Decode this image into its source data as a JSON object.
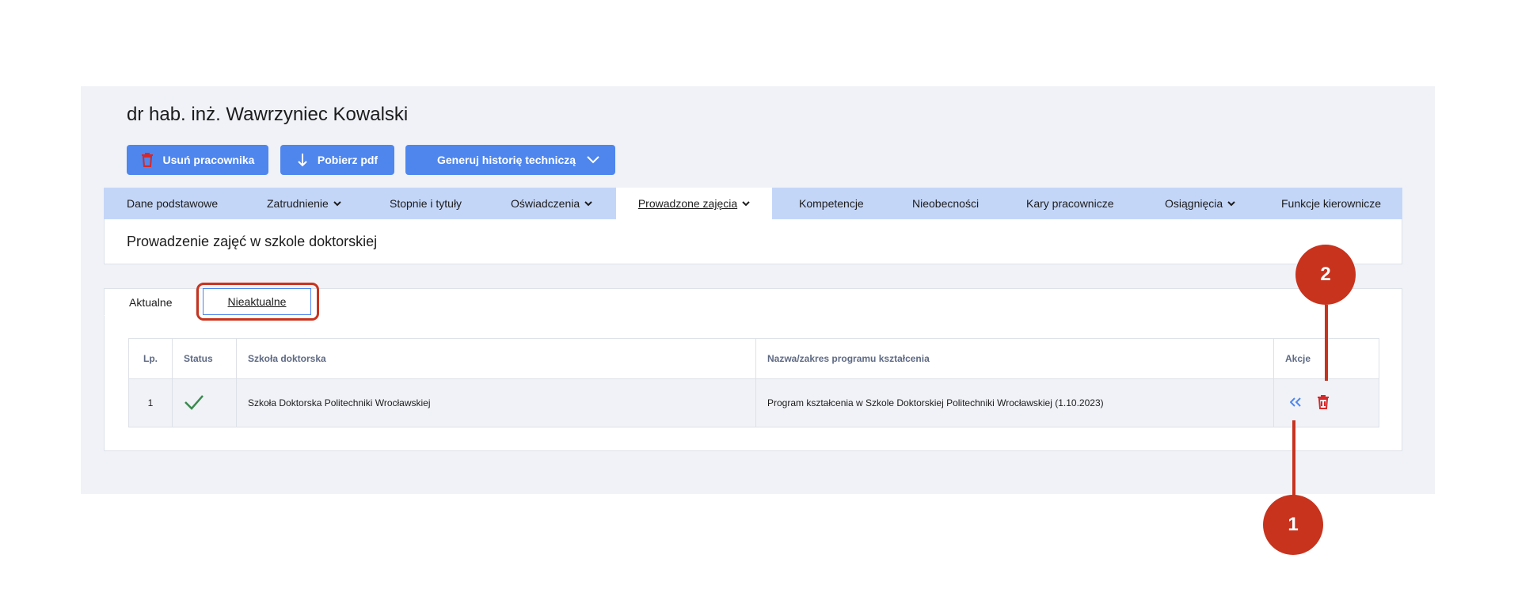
{
  "header": {
    "person_name": "dr hab. inż. Wawrzyniec Kowalski"
  },
  "toolbar": {
    "delete_label": "Usuń pracownika",
    "pdf_label": "Pobierz pdf",
    "generate_label": "Generuj historię techniczą"
  },
  "nav": {
    "tabs": [
      {
        "label": "Dane podstawowe"
      },
      {
        "label": "Zatrudnienie"
      },
      {
        "label": "Stopnie i tytuły"
      },
      {
        "label": "Oświadczenia"
      },
      {
        "label": "Prowadzone zajęcia"
      },
      {
        "label": "Kompetencje"
      },
      {
        "label": "Nieobecności"
      },
      {
        "label": "Kary pracownicze"
      },
      {
        "label": "Osiągnięcia"
      },
      {
        "label": "Funkcje kierownicze"
      }
    ]
  },
  "section": {
    "title": "Prowadzenie zajęć w szkole doktorskiej"
  },
  "subtabs": {
    "current": "Aktualne",
    "archived": "Nieaktualne"
  },
  "table": {
    "headers": [
      "Lp.",
      "Status",
      "Szkoła doktorska",
      "Nazwa/zakres programu kształcenia",
      "Akcje"
    ],
    "rows": [
      {
        "lp": "1",
        "status": "active",
        "school": "Szkoła Doktorska Politechniki Wrocławskiej",
        "program": "Program kształcenia w Szkole Doktorskiej Politechniki Wrocławskiej (1.10.2023)"
      }
    ]
  },
  "callouts": {
    "one": "1",
    "two": "2"
  },
  "colors": {
    "accent": "#4e86ee",
    "callout": "#c8331e",
    "tabbar": "#c4d6f8",
    "check": "#3a8a4e",
    "delete": "#d62828"
  }
}
